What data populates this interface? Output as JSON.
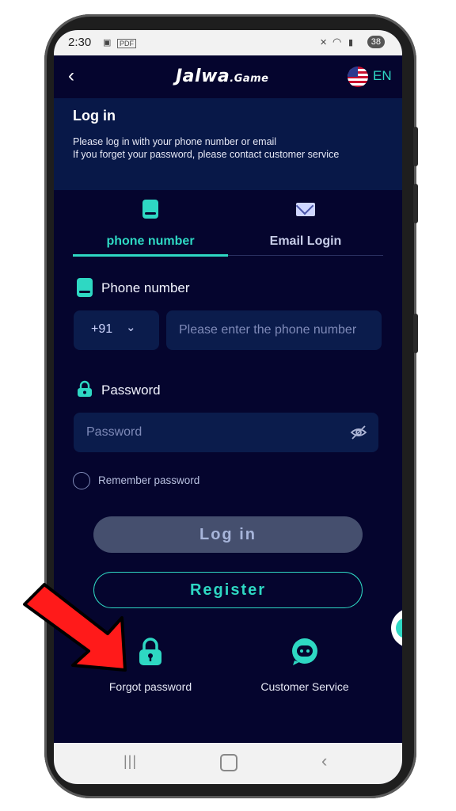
{
  "status_bar": {
    "time": "2:30",
    "battery": "38",
    "pdf_label": "PDF"
  },
  "app_bar": {
    "back_icon": "chevron-left-icon",
    "logo_main": "Jalwa",
    "logo_suffix": ".Game",
    "language": "EN"
  },
  "hero": {
    "title": "Log in",
    "line1": "Please log in with your phone number or email",
    "line2": "If you forget your password, please contact customer service"
  },
  "tabs": [
    {
      "label": "phone number",
      "icon": "phone-icon",
      "active": true
    },
    {
      "label": "Email Login",
      "icon": "envelope-icon",
      "active": false
    }
  ],
  "phone_field": {
    "label": "Phone number",
    "country_code": "+91",
    "placeholder": "Please enter the phone number"
  },
  "password_field": {
    "label": "Password",
    "placeholder": "Password"
  },
  "remember": {
    "label": "Remember password"
  },
  "buttons": {
    "login": "Log in",
    "register": "Register"
  },
  "bottom": {
    "forgot": "Forgot password",
    "customer_service": "Customer Service"
  },
  "colors": {
    "accent": "#2ed8c3",
    "background": "#05052e",
    "field": "#0b1c4c",
    "annotation_arrow": "#ff1a1a"
  }
}
